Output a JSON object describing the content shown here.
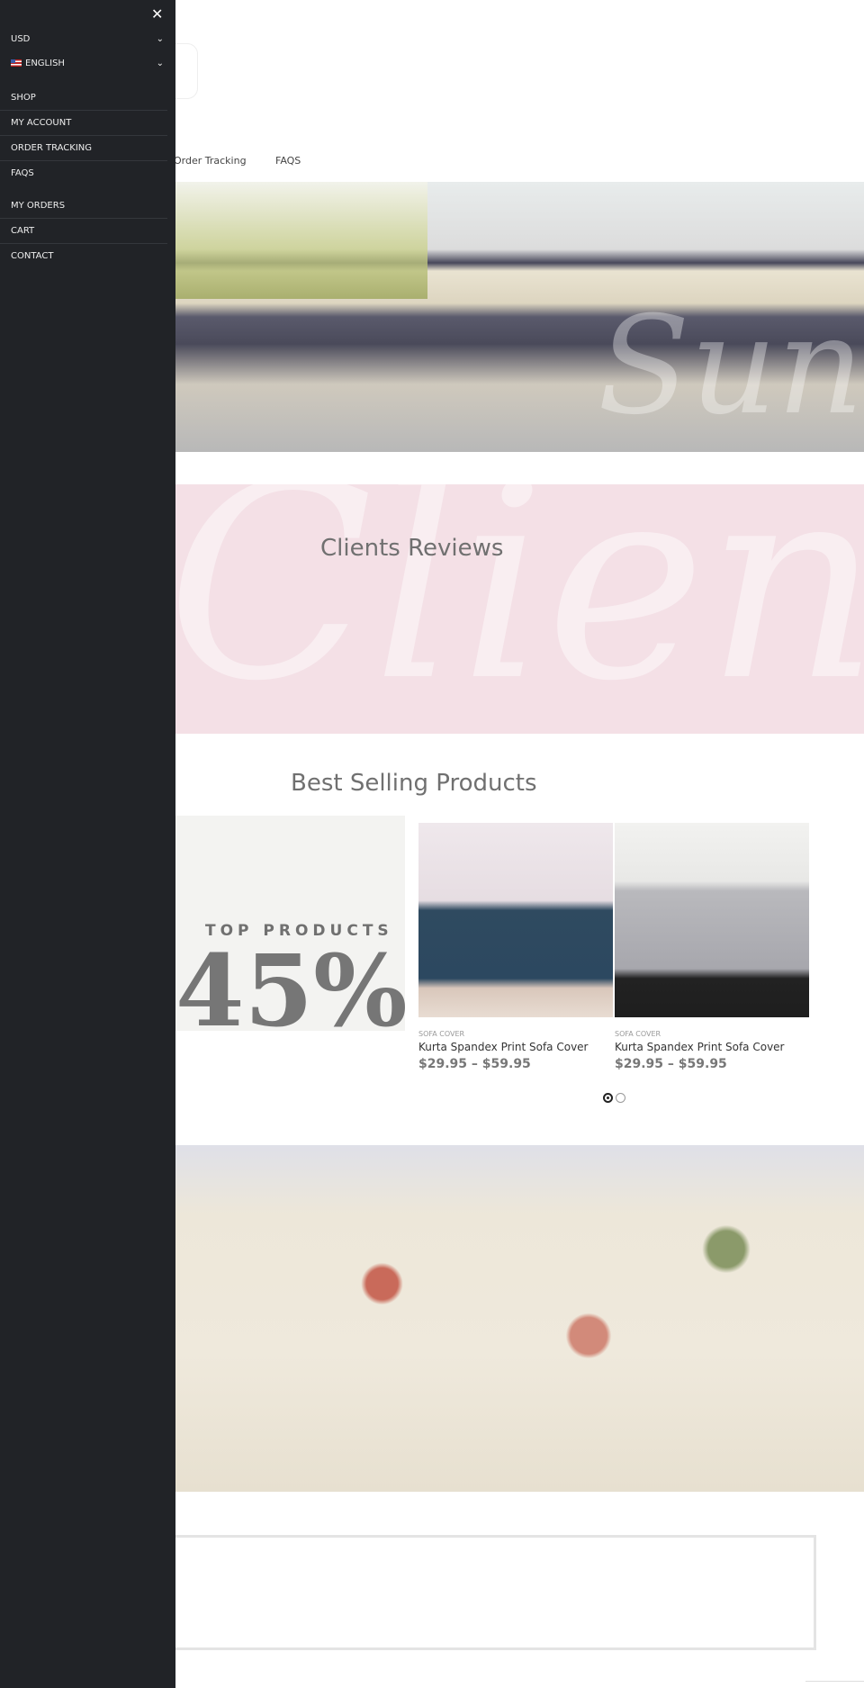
{
  "sidebar": {
    "close_icon": "close-icon",
    "currency": "USD",
    "language": "ENGLISH",
    "menu_primary": [
      "SHOP",
      "MY ACCOUNT",
      "ORDER TRACKING",
      "FAQS"
    ],
    "menu_secondary": [
      "MY ORDERS",
      "CART",
      "CONTACT"
    ]
  },
  "nav": {
    "order_tracking": "Order Tracking",
    "faqs": "FAQS"
  },
  "hero": {
    "script": "Sun"
  },
  "reviews": {
    "title": "Clients Reviews",
    "script": "Client"
  },
  "best": {
    "title": "Best Selling Products",
    "promo_label": "TOP PRODUCTS",
    "promo_value": "45%",
    "products": [
      {
        "category": "SOFA COVER",
        "name": "Kurta Spandex Print Sofa Cover",
        "price": "$29.95 – $59.95"
      },
      {
        "category": "SOFA COVER",
        "name": "Kurta Spandex Print Sofa Cover",
        "price": "$29.95 – $59.95"
      }
    ],
    "active_page": 1,
    "pages": 2
  },
  "colors": {
    "sidebar": "#212327",
    "pink": "#f4e0e6"
  }
}
